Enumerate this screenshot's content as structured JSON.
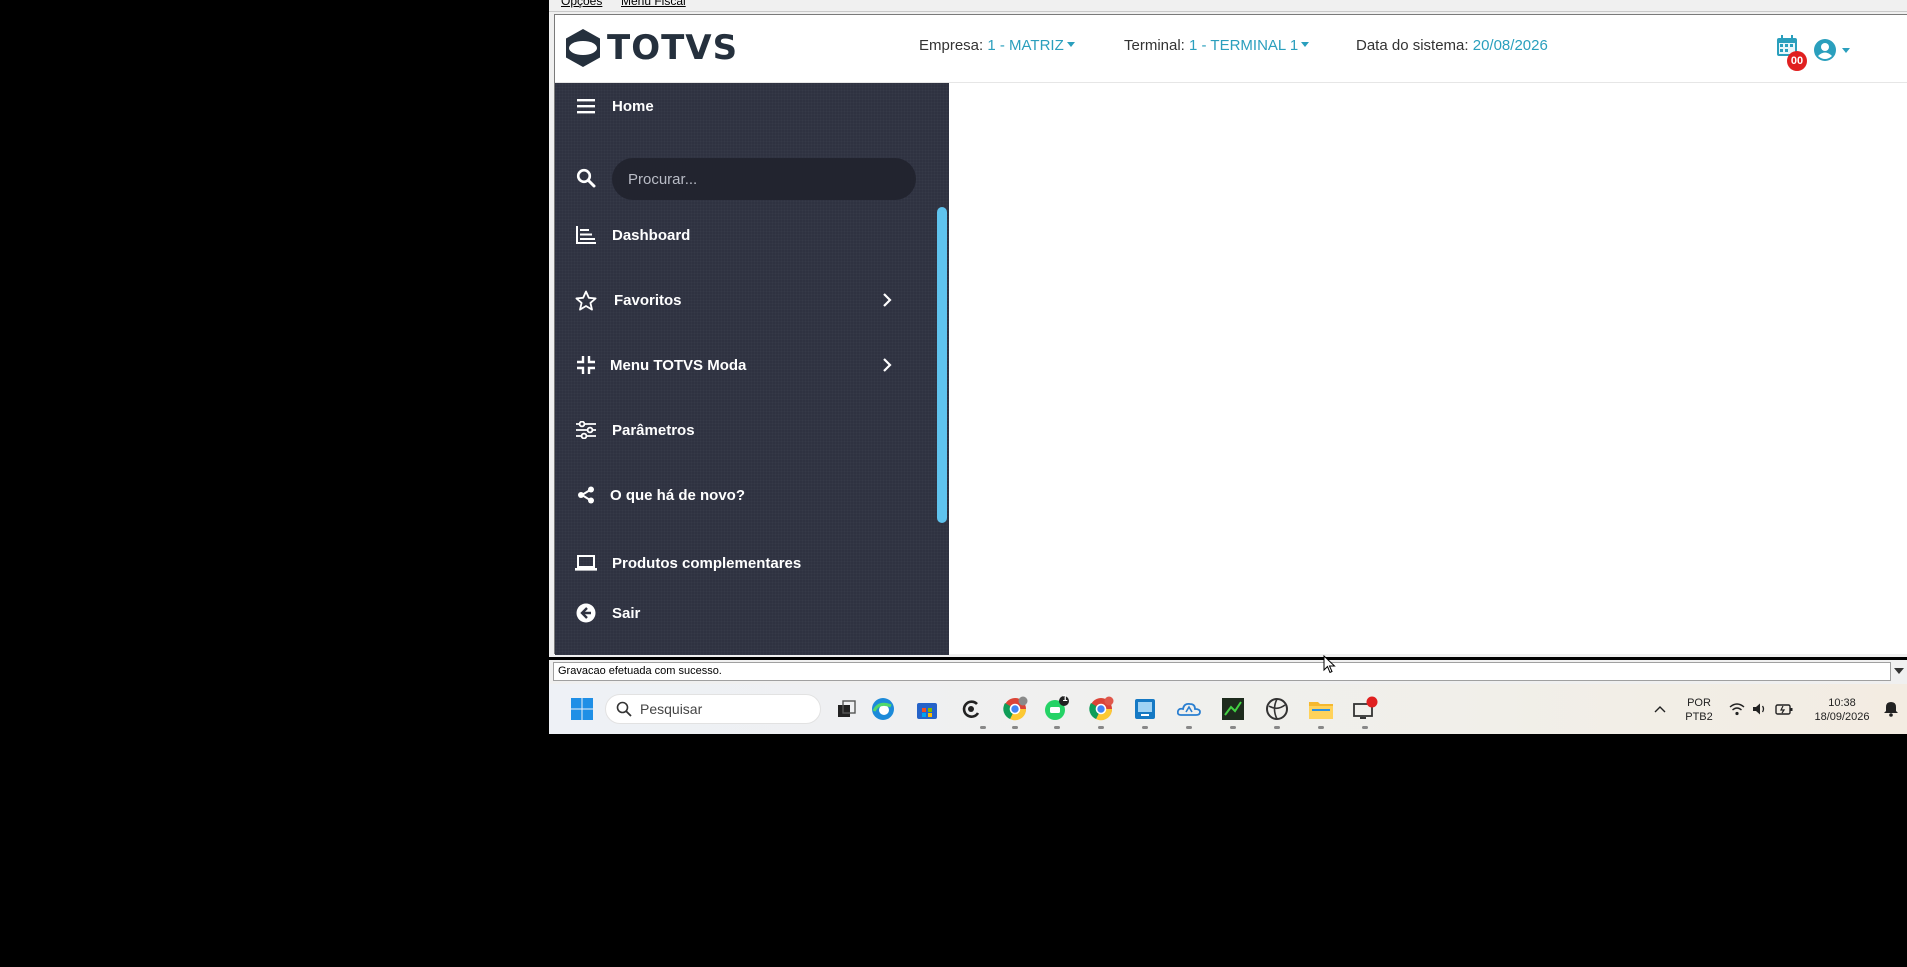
{
  "legacy_menu": {
    "item1": "Opções",
    "item2": "Menu Fiscal"
  },
  "header": {
    "logo_text": "TOTVS",
    "empresa_label": "Empresa:",
    "empresa_value": "1 - MATRIZ",
    "terminal_label": "Terminal:",
    "terminal_value": "1 - TERMINAL 1",
    "data_label": "Data do sistema:",
    "data_value": "20/08/2026",
    "notification_count": "00",
    "accent_color": "#2a9fbd"
  },
  "sidebar": {
    "home": "Home",
    "search_placeholder": "Procurar...",
    "items": [
      {
        "label": "Dashboard",
        "icon": "bar-chart-icon",
        "has_submenu": false
      },
      {
        "label": "Favoritos",
        "icon": "star-icon",
        "has_submenu": true
      },
      {
        "label": "Menu TOTVS Moda",
        "icon": "compress-icon",
        "has_submenu": true
      },
      {
        "label": "Parâmetros",
        "icon": "sliders-icon",
        "has_submenu": false
      },
      {
        "label": "O que há de novo?",
        "icon": "share-icon",
        "has_submenu": false
      },
      {
        "label": "Produtos complementares",
        "icon": "laptop-icon",
        "has_submenu": false
      },
      {
        "label": "Sair",
        "icon": "arrow-left-circle-icon",
        "has_submenu": false
      }
    ],
    "bg_color": "#2f3241",
    "scrollbar_color": "#5fc3ee"
  },
  "status_bar": {
    "message": "Gravacao efetuada com sucesso."
  },
  "taskbar": {
    "search_placeholder": "Pesquisar",
    "whatsapp_badge": "1",
    "language": "POR",
    "layout": "PTB2",
    "time": "10:38",
    "date": "18/09/2026"
  }
}
